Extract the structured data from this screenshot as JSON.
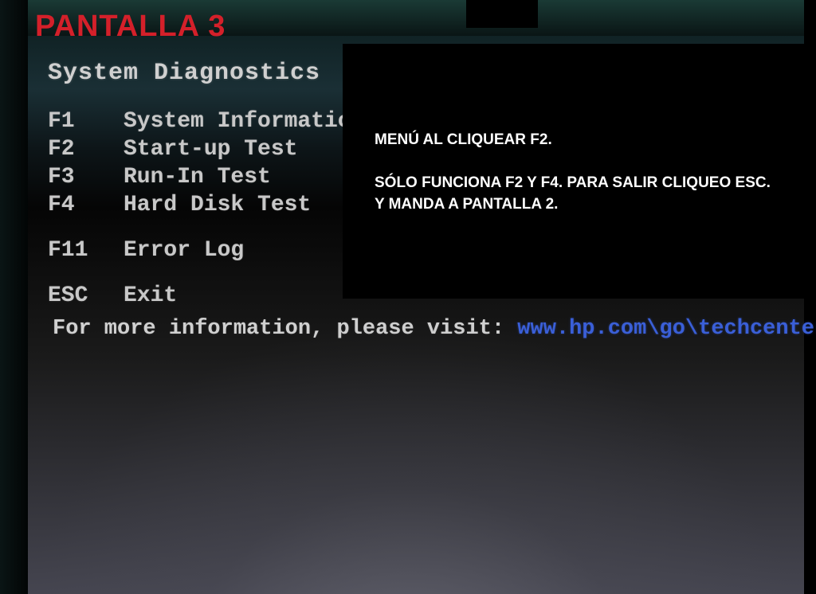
{
  "annotation": {
    "title": "PANTALLA 3",
    "box_line1": "MENÚ AL CLIQUEAR F2.",
    "box_line2": "SÓLO FUNCIONA F2 Y F4. PARA SALIR CLIQUEO ESC. Y MANDA A PANTALLA 2."
  },
  "bios": {
    "heading": "System Diagnostics",
    "menu": [
      {
        "key": "F1",
        "label": "System Information"
      },
      {
        "key": "F2",
        "label": "Start-up Test"
      },
      {
        "key": "F3",
        "label": "Run-In Test"
      },
      {
        "key": "F4",
        "label": "Hard Disk Test"
      }
    ],
    "menu2": [
      {
        "key": "F11",
        "label": "Error Log"
      }
    ],
    "menu3": [
      {
        "key": "ESC",
        "label": "Exit"
      }
    ],
    "info_prefix": "For more information, please visit: ",
    "info_url": "www.hp.com\\go\\techcenter\\start"
  }
}
